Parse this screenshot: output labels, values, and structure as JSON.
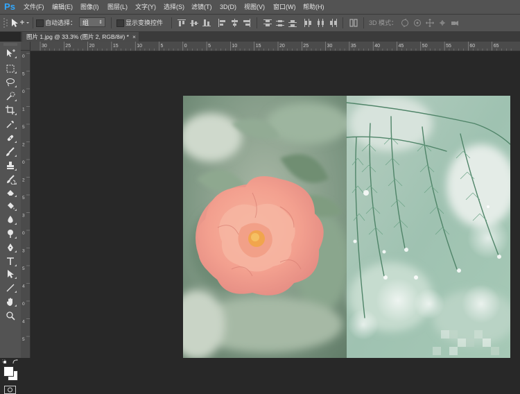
{
  "app": {
    "logo": "Ps"
  },
  "menu": [
    "文件(F)",
    "编辑(E)",
    "图像(I)",
    "图层(L)",
    "文字(Y)",
    "选择(S)",
    "滤镜(T)",
    "3D(D)",
    "视图(V)",
    "窗口(W)",
    "帮助(H)"
  ],
  "options": {
    "auto_select_label": "自动选择：",
    "auto_select_value": "组",
    "show_transform_label": "显示变换控件",
    "mode_3d_label": "3D 模式："
  },
  "document": {
    "tab_title": "图片 1.jpg @ 33.3% (图片 2, RGB/8#) *",
    "close_glyph": "×"
  },
  "ruler": {
    "top_labels": [
      "30",
      "25",
      "20",
      "15",
      "10",
      "5",
      "0",
      "5",
      "10",
      "15",
      "20",
      "25",
      "30",
      "35",
      "40",
      "45",
      "50",
      "55",
      "60",
      "65"
    ],
    "left_labels": [
      "0",
      "5",
      "0",
      "1",
      "5",
      "2",
      "0",
      "2",
      "5",
      "3",
      "0",
      "3",
      "5",
      "4",
      "0",
      "4",
      "5"
    ]
  },
  "icons": {
    "tools": [
      "move-tool-icon",
      "marquee-tool-icon",
      "lasso-tool-icon",
      "quick-selection-tool-icon",
      "crop-tool-icon",
      "eyedropper-tool-icon",
      "healing-brush-tool-icon",
      "brush-tool-icon",
      "clone-stamp-tool-icon",
      "history-brush-tool-icon",
      "eraser-tool-icon",
      "paint-bucket-tool-icon",
      "blur-tool-icon",
      "dodge-tool-icon",
      "pen-tool-icon",
      "type-tool-icon",
      "path-selection-tool-icon",
      "line-tool-icon",
      "hand-tool-icon",
      "zoom-tool-icon"
    ]
  },
  "colors": {
    "foreground": "#ffffff",
    "background": "#ffffff",
    "accent": "#31a8ff"
  }
}
